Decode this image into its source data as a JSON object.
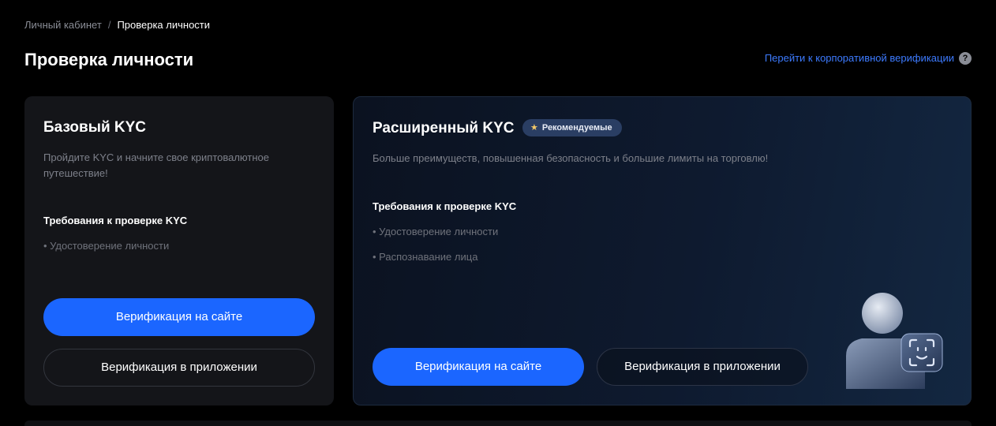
{
  "breadcrumb": {
    "parent": "Личный кабинет",
    "separator": "/",
    "current": "Проверка личности"
  },
  "page": {
    "title": "Проверка личности",
    "corporate_link": "Перейти к корпоративной верификации",
    "help_icon": "?"
  },
  "basic": {
    "title": "Базовый KYC",
    "description": "Пройдите KYC и начните свое криптовалютное путешествие!",
    "requirements_title": "Требования к проверке KYC",
    "requirements": [
      "• Удостоверение личности"
    ],
    "btn_site": "Верификация на сайте",
    "btn_app": "Верификация в приложении"
  },
  "advanced": {
    "title": "Расширенный KYC",
    "badge_icon": "★",
    "badge": "Рекомендуемые",
    "description": "Больше преимуществ, повышенная безопасность и большие лимиты на торговлю!",
    "requirements_title": "Требования к проверке KYC",
    "requirements": [
      "• Удостоверение личности",
      "• Распознавание лица"
    ],
    "btn_site": "Верификация на сайте",
    "btn_app": "Верификация в приложении",
    "illustration_icon": "face-id-user-icon"
  },
  "colors": {
    "accent": "#1b66ff",
    "link": "#3d7bff",
    "badge_bg": "#2a3e63",
    "card_bg": "#141519"
  }
}
